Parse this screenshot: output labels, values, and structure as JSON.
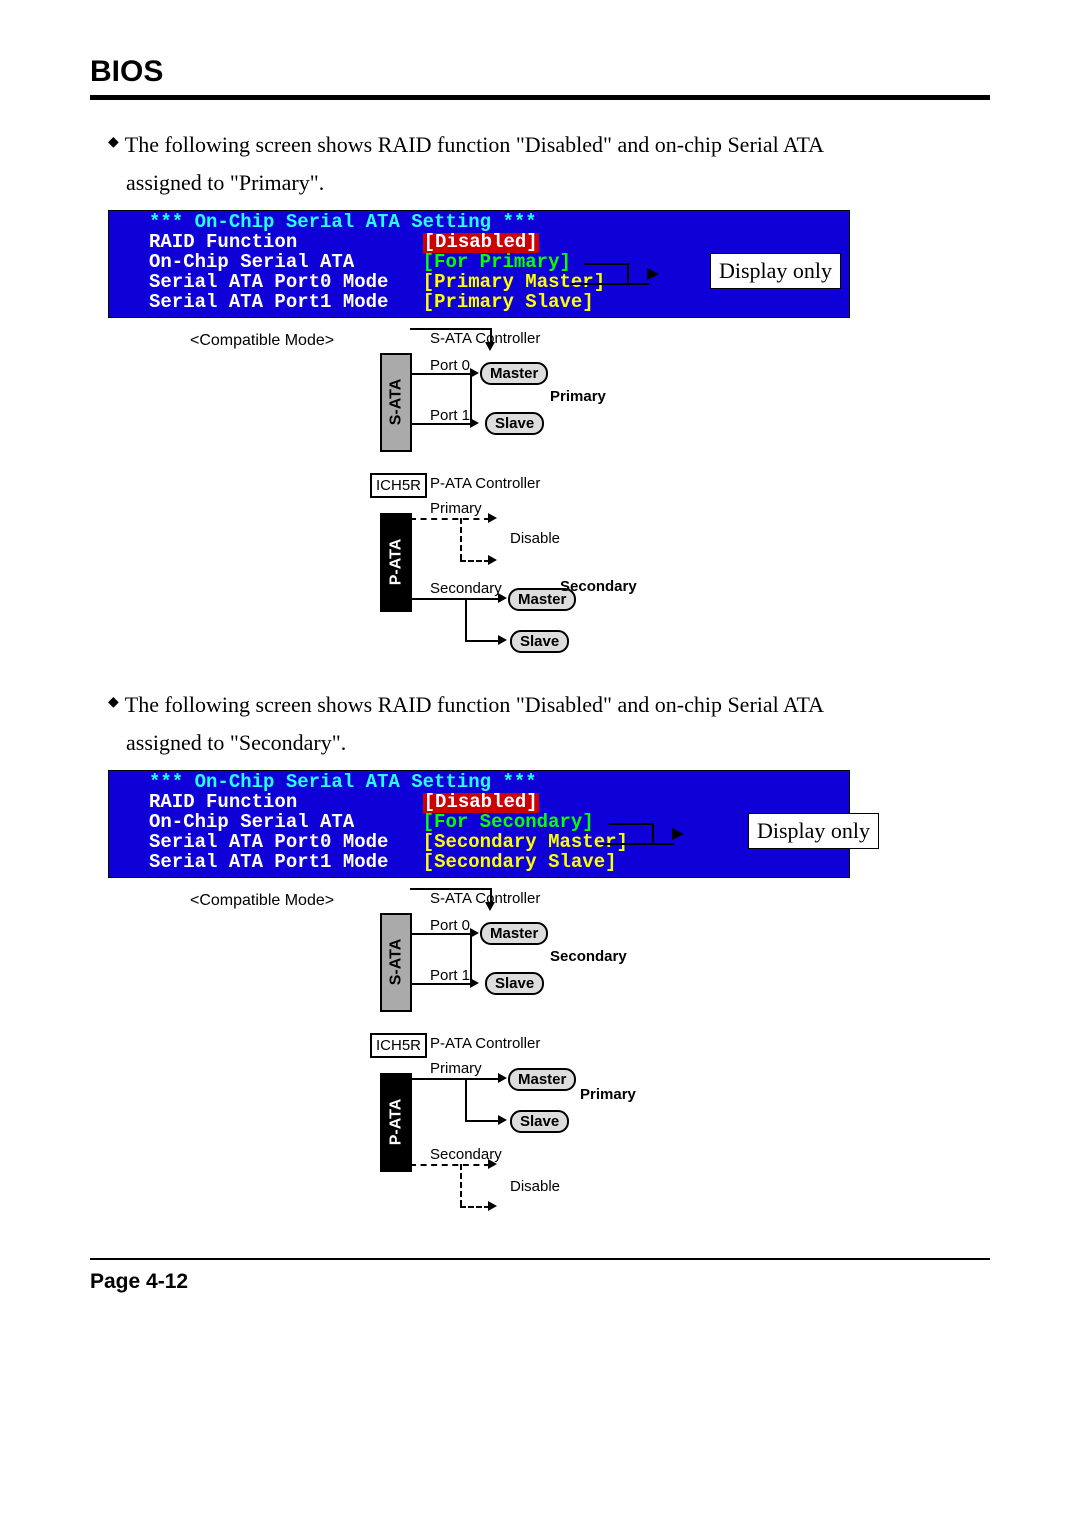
{
  "header": {
    "title": "BIOS"
  },
  "footer": {
    "page": "Page 4-12"
  },
  "sections": [
    {
      "text1": "The following screen shows RAID function \"Disabled\" and on-chip Serial ATA",
      "text2": "assigned to \"Primary\".",
      "bios": {
        "heading": "*** On-Chip Serial ATA Setting ***",
        "rows": [
          {
            "label": "RAID Function",
            "value": "[Disabled]",
            "vclass": "redbg"
          },
          {
            "label": "On-Chip Serial ATA",
            "value": "[For Primary]",
            "vclass": "green"
          },
          {
            "label": "Serial ATA Port0 Mode",
            "value": "[Primary Master]",
            "vclass": "yellow"
          },
          {
            "label": "Serial ATA Port1 Mode",
            "value": "[Primary Slave]",
            "vclass": "yellow"
          }
        ],
        "display": "Display only"
      },
      "diagram": {
        "compatible": "<Compatible Mode>",
        "sata": "S-ATA",
        "pata": "P-ATA",
        "ich": "ICH5R",
        "sata_ctrl": "S-ATA Controller",
        "pata_ctrl": "P-ATA Controller",
        "port0": "Port 0",
        "port1": "Port 1",
        "master": "Master",
        "slave": "Slave",
        "primary_bold": "Primary",
        "secondary_bold": "Secondary",
        "primary": "Primary",
        "secondary": "Secondary",
        "disable": "Disable",
        "sata_group": "Primary",
        "pata_active_label": "Secondary",
        "pata_disabled_label": "Primary",
        "pata_group": "Secondary",
        "pata_disable_top": true
      }
    },
    {
      "text1": "The following screen shows RAID function \"Disabled\" and on-chip Serial ATA",
      "text2": "assigned to \"Secondary\".",
      "bios": {
        "heading": "*** On-Chip Serial ATA Setting ***",
        "rows": [
          {
            "label": "RAID Function",
            "value": "[Disabled]",
            "vclass": "redbg"
          },
          {
            "label": "On-Chip Serial ATA",
            "value": "[For Secondary]",
            "vclass": "green"
          },
          {
            "label": "Serial ATA Port0 Mode",
            "value": "[Secondary Master]",
            "vclass": "yellow"
          },
          {
            "label": "Serial ATA Port1 Mode",
            "value": "[Secondary Slave]",
            "vclass": "yellow"
          }
        ],
        "display": "Display only"
      },
      "diagram": {
        "compatible": "<Compatible Mode>",
        "sata": "S-ATA",
        "pata": "P-ATA",
        "ich": "ICH5R",
        "sata_ctrl": "S-ATA Controller",
        "pata_ctrl": "P-ATA Controller",
        "port0": "Port 0",
        "port1": "Port 1",
        "master": "Master",
        "slave": "Slave",
        "primary_bold": "Primary",
        "secondary_bold": "Secondary",
        "primary": "Primary",
        "secondary": "Secondary",
        "disable": "Disable",
        "sata_group": "Secondary",
        "pata_active_label": "Primary",
        "pata_disabled_label": "Secondary",
        "pata_group": "Primary",
        "pata_disable_top": false
      }
    }
  ]
}
